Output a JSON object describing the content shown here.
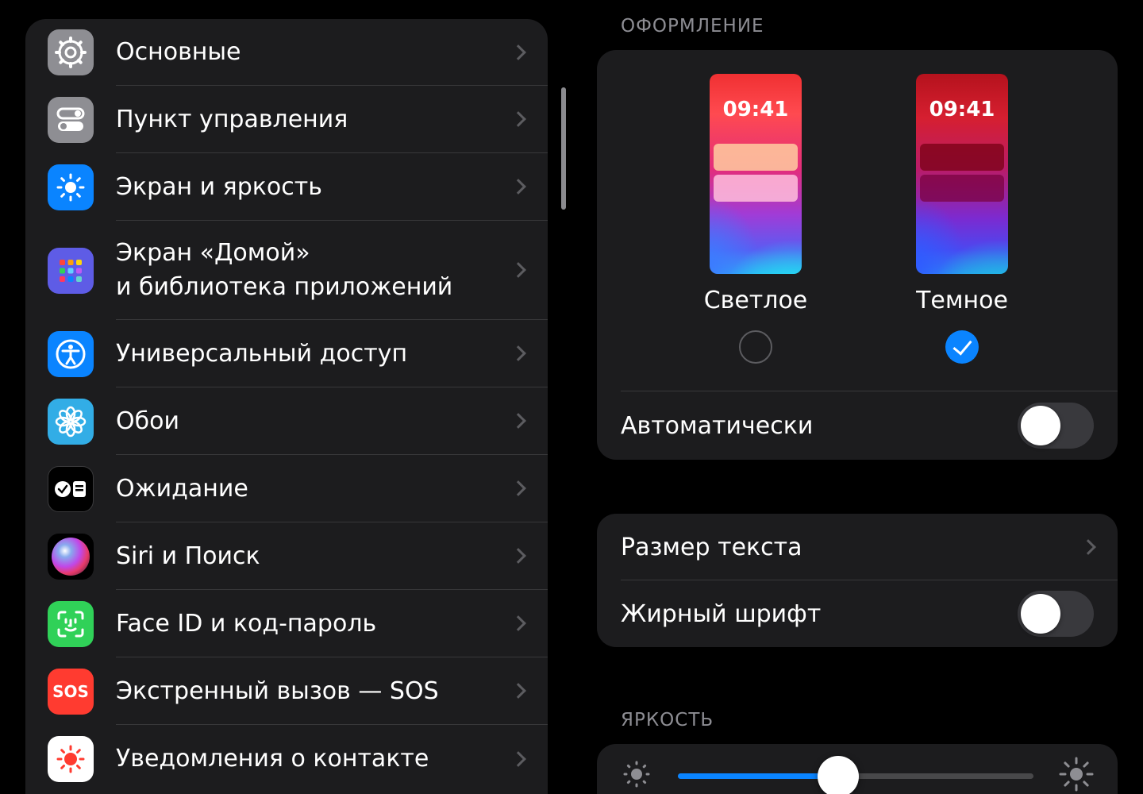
{
  "sidebar": {
    "items": [
      {
        "label": "Основные",
        "icon": "gear-icon",
        "color": "#8e8e93"
      },
      {
        "label": "Пункт управления",
        "icon": "switches-icon",
        "color": "#8e8e93"
      },
      {
        "label": "Экран и яркость",
        "icon": "sun-icon",
        "color": "#0a84ff"
      },
      {
        "label": "Экран «Домой»\nи библиотека приложений",
        "icon": "app-grid-icon",
        "color": "#5e5ce6"
      },
      {
        "label": "Универсальный доступ",
        "icon": "accessibility-icon",
        "color": "#0a84ff"
      },
      {
        "label": "Обои",
        "icon": "flower-icon",
        "color": "#32ade6"
      },
      {
        "label": "Ожидание",
        "icon": "standby-icon",
        "color": "#000000"
      },
      {
        "label": "Siri и Поиск",
        "icon": "siri-icon",
        "color": "#000000"
      },
      {
        "label": "Face ID и код-пароль",
        "icon": "face-id-icon",
        "color": "#30d158"
      },
      {
        "label": "Экстренный вызов — SOS",
        "icon": "sos-icon",
        "color": "#ff3b30",
        "icon_text": "SOS"
      },
      {
        "label": "Уведомления о контакте",
        "icon": "exposure-icon",
        "color": "#ffffff"
      }
    ]
  },
  "appearance": {
    "header": "ОФОРМЛЕНИЕ",
    "light": {
      "label": "Светлое",
      "time": "09:41",
      "selected": false
    },
    "dark": {
      "label": "Темное",
      "time": "09:41",
      "selected": true
    },
    "auto": {
      "label": "Автоматически",
      "on": false
    }
  },
  "text": {
    "size_label": "Размер текста",
    "bold": {
      "label": "Жирный шрифт",
      "on": false
    }
  },
  "brightness": {
    "header": "ЯРКОСТЬ",
    "value": 0.45
  },
  "colors": {
    "accent": "#0a84ff",
    "panel": "#1c1c1e",
    "background": "#000000"
  }
}
